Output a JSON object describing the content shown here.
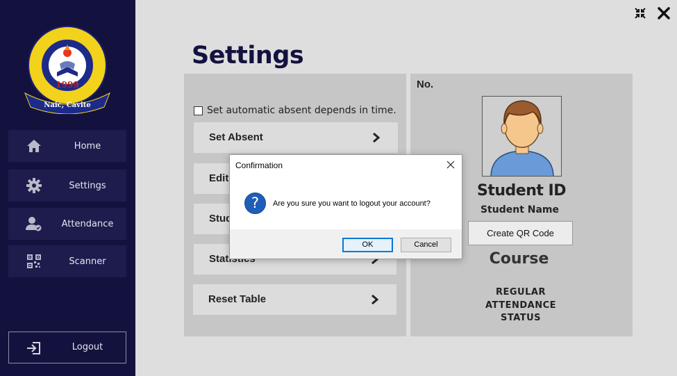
{
  "sidebar": {
    "logo": {
      "ring_text": "GRABY COLLEGES OF SCIENCE AND TECHNOLOGY",
      "year": "1999",
      "ribbon": "Naic, Cavite"
    },
    "items": [
      {
        "label": "Home",
        "icon": "home-icon"
      },
      {
        "label": "Settings",
        "icon": "gear-icon"
      },
      {
        "label": "Attendance",
        "icon": "user-check-icon"
      },
      {
        "label": "Scanner",
        "icon": "qr-code-icon"
      }
    ],
    "logout_label": "Logout"
  },
  "page": {
    "title": "Settings"
  },
  "settings_panel": {
    "auto_absent_label": "Set automatic absent depends in time.",
    "auto_absent_checked": false,
    "options": [
      {
        "label": "Set Absent"
      },
      {
        "label": "Edit"
      },
      {
        "label": "Stud"
      },
      {
        "label": "Statistics"
      },
      {
        "label": "Reset Table"
      }
    ]
  },
  "student_panel": {
    "no_label": "No.",
    "student_id": "Student ID",
    "student_name": "Student Name",
    "qr_button": "Create QR Code",
    "course": "Course",
    "status_lines": [
      "REGULAR",
      "ATTENDANCE",
      "STATUS"
    ]
  },
  "dialog": {
    "title": "Confirmation",
    "icon": "?",
    "message": "Are you sure you want to logout your account?",
    "ok_label": "OK",
    "cancel_label": "Cancel"
  },
  "colors": {
    "sidebar_bg": "#13123f",
    "nav_item_bg": "#1d1c4d",
    "accent_title": "#13123f",
    "panel_bg": "#c6c6c6",
    "dialog_icon": "#1f5eb8",
    "ok_border": "#0078d7"
  }
}
